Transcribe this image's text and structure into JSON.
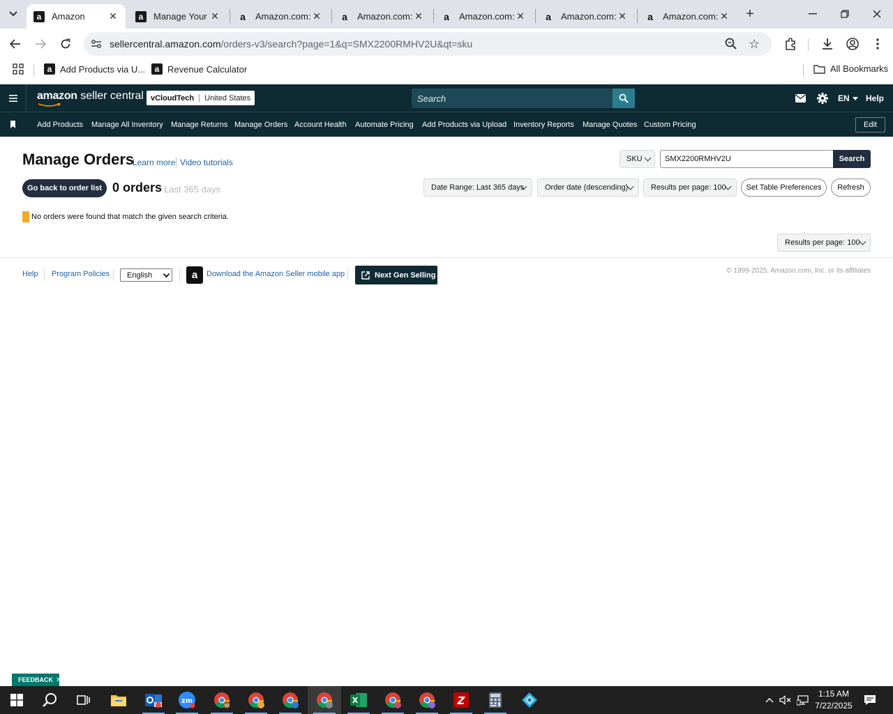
{
  "browser": {
    "tabs": [
      {
        "title": "Amazon",
        "active": true
      },
      {
        "title": "Manage Your",
        "active": false
      },
      {
        "title": "Amazon.com:",
        "active": false
      },
      {
        "title": "Amazon.com:",
        "active": false
      },
      {
        "title": "Amazon.com:",
        "active": false
      },
      {
        "title": "Amazon.com:",
        "active": false
      },
      {
        "title": "Amazon.com:",
        "active": false
      }
    ],
    "url_host": "sellercentral.amazon.com",
    "url_path": "/orders-v3/search?page=1&q=SMX2200RMHV2U&qt=sku",
    "bookmarks": [
      "Add Products via U...",
      "Revenue Calculator"
    ],
    "all_bookmarks": "All Bookmarks"
  },
  "header": {
    "logo_text": "amazon seller central",
    "logo_brand": "amazon",
    "logo_product": "seller central",
    "account_name": "vCloudTech",
    "marketplace": "United States",
    "search_placeholder": "Search",
    "language": "EN",
    "help": "Help"
  },
  "nav": {
    "items": [
      "Add Products",
      "Manage All Inventory",
      "Manage Returns",
      "Manage Orders",
      "Account Health",
      "Automate Pricing",
      "Add Products via Upload",
      "Inventory Reports",
      "Manage Quotes",
      "Custom Pricing"
    ],
    "edit": "Edit"
  },
  "page": {
    "title": "Manage Orders",
    "learn_more": "Learn more",
    "video_tutorials": "Video tutorials",
    "search_type": "SKU",
    "search_value": "SMX2200RMHV2U",
    "search_button": "Search",
    "back_button": "Go back to order list",
    "order_count": "0 orders",
    "order_range": "Last 365 days",
    "filters": {
      "date_range": "Date Range: Last 365 days",
      "sort": "Order date (descending)",
      "results_per_page": "Results per page: 100",
      "table_prefs": "Set Table Preferences",
      "refresh": "Refresh"
    },
    "empty_message": "No orders were found that match the given search criteria.",
    "results_per_page_bottom": "Results per page: 100"
  },
  "footer": {
    "help": "Help",
    "program_policies": "Program Policies",
    "language": "English",
    "download_app": "Download the Amazon Seller mobile app",
    "next_gen": "Next Gen Selling",
    "copyright": "© 1999-2025, Amazon.com, Inc. or its affiliates"
  },
  "feedback": {
    "label": "FEEDBACK"
  },
  "taskbar": {
    "apps": [
      "windows-start",
      "search",
      "task-view",
      "file-explorer",
      "outlook",
      "zoom",
      "chrome-w",
      "chrome-profile-1",
      "chrome-profile-2",
      "chrome-profile-3",
      "excel",
      "chrome-profile-4",
      "chrome-profile-5",
      "filezilla",
      "calculator",
      "app-diamond"
    ],
    "time": "1:15 AM",
    "date": "7/22/2025"
  },
  "colors": {
    "header_bg": "#0e2a33",
    "search_bg": "#1d4956",
    "search_btn": "#2b7d8e",
    "alert_bar": "#f7a928",
    "link": "#2162a1",
    "dark_button": "#232f3e",
    "feedback": "#00796b"
  }
}
